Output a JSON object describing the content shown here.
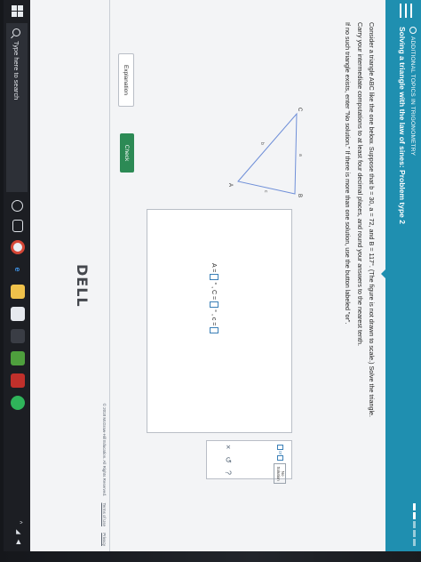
{
  "header": {
    "topic": "ADDITIONAL TOPICS IN TRIGONOMETRY",
    "title": "Solving a triangle with the law of sines: Problem type 2"
  },
  "problem": {
    "line1": "Consider a triangle ABC like the one below. Suppose that b = 30, a = 72, and B = 117°. (The figure is not drawn to scale.) Solve the triangle.",
    "line2": "Carry your intermediate computations to at least four decimal places, and round your answers to the nearest tenth.",
    "line3": "If no such triangle exists, enter \"No solution.\" If there is more than one solution, use the button labeled \"or\"."
  },
  "figure": {
    "vertex_a": "A",
    "vertex_b": "B",
    "vertex_c": "C",
    "side_a": "a",
    "side_b": "b",
    "side_c": "c",
    "color": "#6f8fd8"
  },
  "answer": {
    "a_label": "A =",
    "a_unit": "°",
    "c_label": ", C =",
    "c_unit": "°",
    "side_label": ", c ="
  },
  "tools": {
    "or_label": "or",
    "no_solution_line1": "No",
    "no_solution_line2": "Solution",
    "clear_symbol": "×",
    "undo_symbol": "↺",
    "help_symbol": "?"
  },
  "buttons": {
    "explanation": "Explanation",
    "check": "Check"
  },
  "footer": {
    "copyright": "© 2018 McGraw-Hill Education. All Rights Reserved.",
    "terms": "Terms of Use",
    "privacy": "Privacy"
  },
  "taskbar": {
    "search_placeholder": "Type here to search"
  },
  "brand": {
    "monitor": "DELL"
  },
  "colors": {
    "header": "#1f8fb0",
    "check_button": "#2c8a55"
  }
}
